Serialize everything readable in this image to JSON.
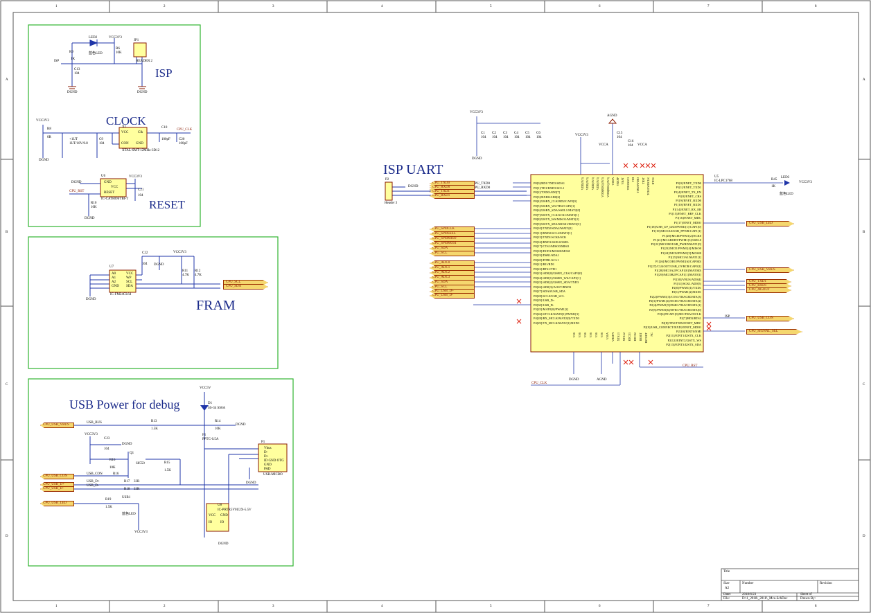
{
  "sections": {
    "isp": "ISP",
    "clock": "CLOCK",
    "reset": "RESET",
    "fram": "FRAM",
    "usb_power": "USB Power for debug",
    "isp_uart": "ISP UART"
  },
  "border": {
    "cols": [
      "1",
      "2",
      "3",
      "4",
      "5",
      "6",
      "7",
      "8"
    ],
    "rows": [
      "A",
      "B",
      "C",
      "D"
    ]
  },
  "isp_block": {
    "vcc": "VCC3V3",
    "led": "LED2",
    "led_color": "蓝色LED",
    "r9": "R9",
    "r9v": "1K",
    "r6": "R6",
    "r6v": "10K",
    "jp": "JP1",
    "jp_name": "HEADER 2",
    "net": "ISP",
    "cap": "C13",
    "capv": "104",
    "gnd": "DGND"
  },
  "clock_block": {
    "vcc": "VCC3V3",
    "r8": "R8",
    "r8v": "0R",
    "cap1": "+1UT",
    "cap1b": "1UT/10V/0.8",
    "c9": "C9",
    "c9v": "104",
    "x": "X1",
    "xpins": [
      "VCC",
      "Clk",
      "CON",
      "GND"
    ],
    "xpart": "XTAL-SMT-12MHz-3D12",
    "c10": "C10",
    "c10v": "100pF",
    "c20": "C20",
    "c20v": "100pF",
    "net": "CPU_CLK",
    "gnd": "DGND"
  },
  "reset_block": {
    "u": "U6",
    "pins": [
      "GND",
      "VCC",
      "RESET"
    ],
    "part": "IC-CAT809STBI-T",
    "vcc": "VCC3V3",
    "c": "C21",
    "cv": "104",
    "r": "R10",
    "rv": "10K",
    "net": "CPU_RST",
    "gnd": "DGND"
  },
  "fram_block": {
    "u": "U7",
    "pins_left": [
      "A0",
      "A1",
      "A2",
      "GND"
    ],
    "pins_right": [
      "VCC",
      "WP",
      "SCL",
      "SDA"
    ],
    "part": "IC-FM24CL64",
    "c": "C22",
    "cv": "104",
    "vcc": "VCC3V3",
    "r1": "R11",
    "r1v": "4.7K",
    "r2": "R12",
    "r2v": "4.7K",
    "nets": [
      "CPU_SCL",
      "CPU_SDA"
    ],
    "gnd": "DGND"
  },
  "usb_block": {
    "vcc5": "VCC5V",
    "d": "D1",
    "dpart": "SS-34 SS0A",
    "nets_left": [
      "CPU_USB_VBUS",
      "CPU_USB_CON",
      "CPU_USB_D+",
      "CPU_USB_D-",
      "CPU_USB_LED"
    ],
    "usb_bus": "USB_BUS",
    "usb_con": "USB_CON",
    "usb_dp": "USB_D+",
    "usb_dm": "USB_D-",
    "r13": "R13",
    "r13v": "1.5K",
    "r14": "R14",
    "r14v": "10K",
    "r15": "R15",
    "r15v": "1.5K",
    "r16": "R16",
    "r16v": "10K",
    "r17": "R17",
    "r17v": "33R",
    "r18": "R18",
    "r18v": "33R",
    "r19": "R19",
    "r19v": "1.5K",
    "f": "F1",
    "fpart": "PPTC-0.5A",
    "c": "C23",
    "cv": "104",
    "q": "Q1",
    "qpart": "S8550",
    "vcc": "VCC3V3",
    "p": "P1",
    "ppins": [
      "Vbus",
      "D-",
      "D+",
      "ID GND OTG",
      "GND",
      "PAD"
    ],
    "ppart": "USB-MICRO",
    "led": "USB1",
    "led_color": "蓝色LED",
    "u": "U8",
    "upart": "IC-PRTR5V0U2X-5.5V",
    "upins": [
      "VCC",
      "IO",
      "GND",
      "IO"
    ],
    "gnd": "DGND"
  },
  "uart": {
    "header": "P2",
    "hpart": "Header 3",
    "nets": [
      "CPU_TXD0",
      "CPU_RXD0"
    ],
    "tx": "CPU_TXD0",
    "rx": "CPU_RXD0",
    "gnd": "DGND"
  },
  "mcu": {
    "ref": "U5",
    "part": "IC-LPC1768",
    "vcc_top": "VCC3V3",
    "agnd": "AGND",
    "vcca": "VCCA",
    "caps": [
      "C1",
      "C2",
      "C3",
      "C4",
      "C5",
      "C6",
      "C15",
      "C16"
    ],
    "capv": "104",
    "left_pins": [
      "P0[0]/RD1/TXD3/SDA1",
      "P0[1]/TD1/RXD3/SCL1",
      "P0[2]/TXD0/AD0[7]",
      "P0[3]/RXD0/AD0[6]",
      "P0[4]/I2SRX_CLK/RD2/CAP2[0]",
      "P0[5]/I2SRX_WS/TD2/CAP2[1]",
      "P0[6]/I2SRX_SDA/SSEL1/MAT2[0]",
      "P0[7]/I2STX_CLK/SCK1/MAT2[1]",
      "P0[8]/I2STX_WS/MISO1/MAT2[2]",
      "P0[9]/I2STX_SDA/MOSI1/MAT2[3]",
      "P0[10]/TXD2/SDA2/MAT3[0]",
      "P0[11]/RXD2/SCL2/MAT3[1]",
      "P0[15]/TXD1/SCK0/SCK",
      "P0[16]/RXD1/SSEL0/SSEL",
      "P0[17]/CTS1/MISO0/MISO",
      "P0[18]/DCD1/MOSI0/MOSI",
      "P0[19]/DSR1/SDA1",
      "P0[20]/DTR1/SCL1",
      "P0[21]/RI1/RD1",
      "P0[22]/RTS1/TD1",
      "P0[23]/AD0[0]/I2SRX_CLK/CAP3[0]",
      "P0[24]/AD0[1]/I2SRX_WS/CAP3[1]",
      "P0[25]/AD0[2]/I2SRX_SDA/TXD3",
      "P0[26]/AD0[3]/AOUT/RXD3",
      "P0[27]/SDA0/USB_SDA",
      "P0[28]/SCL0/USB_SCL",
      "P0[29]/USB_D+",
      "P0[30]/USB_D-",
      "P3[25]/MAT0[0]/PWM1[2]",
      "P3[26]/STCLK/MAT0[1]/PWM1[3]",
      "P4[28]/RX_MCLK/MAT2[0]/TXD3",
      "P4[29]/TX_MCLK/MAT2[1]/RXD3"
    ],
    "right_pins": [
      "P1[0]/ENET_TXD0",
      "P1[1]/ENET_TXD1",
      "P1[4]/ENET_TX_EN",
      "P1[8]/ENET_CRS",
      "P1[9]/ENET_RXD0",
      "P1[10]/ENET_RXD1",
      "P1[14]/ENET_RX_ER",
      "P1[15]/ENET_REF_CLK",
      "P1[16]/ENET_MDC",
      "P1[17]/ENET_MDIO",
      "P1[18]/USB_UP_LED/PWM1[1]/CAP1[0]",
      "P1[19]/MCOA0/USB_PPWR/CAP1[1]",
      "P1[20]/MCI0/PWM1[2]/SCK0",
      "P1[21]/MCABORT/PWM1[3]/SSEL0",
      "P1[22]/MCOB0/USB_PWRD/MAT1[0]",
      "P1[23]/MCI1/PWM1[4]/MISO0",
      "P1[24]/MCI2/PWM1[5]/MOSI0",
      "P1[25]/MCOA1/MAT1[1]",
      "P1[26]/MCOB1/PWM1[6]/CAP0[0]",
      "P1[27]/CLKOUT/USB_OVRCR/CAP0[1]",
      "P1[28]/MCOA2/PCAP1[0]/MAT0[0]",
      "P1[29]/MCOB2/PCAP1[1]/MAT0[1]",
      "P1[30]/VBUS/AD0[4]",
      "P1[31]/SCK1/AD0[5]",
      "P2[0]/PWM1[1]/TXD1",
      "P2[1]/PWM1[2]/RXD1",
      "P2[2]/PWM1[3]/CTS1/TRACEDATA[3]",
      "P2[3]/PWM1[4]/DCD1/TRACEDATA[2]",
      "P2[4]/PWM1[5]/DSR1/TRACEDATA[1]",
      "P2[5]/PWM1[6]/DTR1/TRACEDATA[0]",
      "P2[6]/PCAP1[0]/RI1/TRACECLK",
      "P2[7]/RD2/RTS1",
      "P2[8]/TD2/TXD2/ENET_MDC",
      "P2[9]/USB_CONNECT/RXD2/ENET_MDIO",
      "P2[10]/EINT0/NMI",
      "P2[11]/EINT1/I2STX_CLK",
      "P2[12]/EINT2/I2STX_WS",
      "P2[13]/EINT3/I2STX_SDA"
    ],
    "top_pins": [
      "VDD(3V3)",
      "VDD(3V3)",
      "VDD(3V3)",
      "VDD(3V3)",
      "VDD(REG)(3V3)",
      "VDD(REG)(3V3)",
      "VDDA",
      "VREFP",
      "VBAT",
      "TDO/SWO",
      "TDI",
      "TMS/SWDIO",
      "TRST",
      "TCK/SWDCLK",
      "RTCK"
    ],
    "bottom_pins": [
      "VSS",
      "VSS",
      "VSS",
      "VSS",
      "VSS",
      "VSS",
      "VSSA",
      "VREFN",
      "XTAL1",
      "XTAL2",
      "RTCX1",
      "RTCX2",
      "RESET",
      "RSTOUT",
      "NC"
    ],
    "left_nets": [
      "CPU_TXD0",
      "CPU_RXD0",
      "CPU_TXD1",
      "CPU_RXD1",
      "CPU_SPI0CLK",
      "CPU_SPI0SSEL",
      "CPU_SPI0MISO",
      "CPU_SPI0MOSI",
      "CPU_SDA",
      "CPU_SCL",
      "CPU_ADC0",
      "CPU_ADC1",
      "CPU_ADC2",
      "CPU_ADC3",
      "CPU_SDA",
      "CPU_SCL",
      "CPU_USB_D+",
      "CPU_USB_D-"
    ],
    "right_nets": [
      "CPU_USB_LED",
      "CPU_USB_VBUS",
      "CPU_TXD1",
      "CPU_RXD1",
      "CPU_485OUT",
      "CPU_USB_CON",
      "CPU_SIGNAL_SEL"
    ],
    "isp_net": "ISP",
    "rst_net": "CPU_RST",
    "clk_net": "CPU_CLK",
    "r_led": "R45",
    "r_ledv": "1K",
    "led": "LED3",
    "led_color": "蓝色LED",
    "led_vcc": "VCC3V3",
    "gnd": "DGND"
  },
  "title_block": {
    "title": "Title",
    "size": "Size",
    "size_val": "A2",
    "number": "Number",
    "revision": "Revision",
    "date": "Date:",
    "date_val": "2018/6/23",
    "sheet": "Sheet of",
    "file": "File:",
    "file_val": "D:\\1_2018\\_2018\\_Mcu.SchDoc",
    "drawn": "Drawn By:"
  }
}
